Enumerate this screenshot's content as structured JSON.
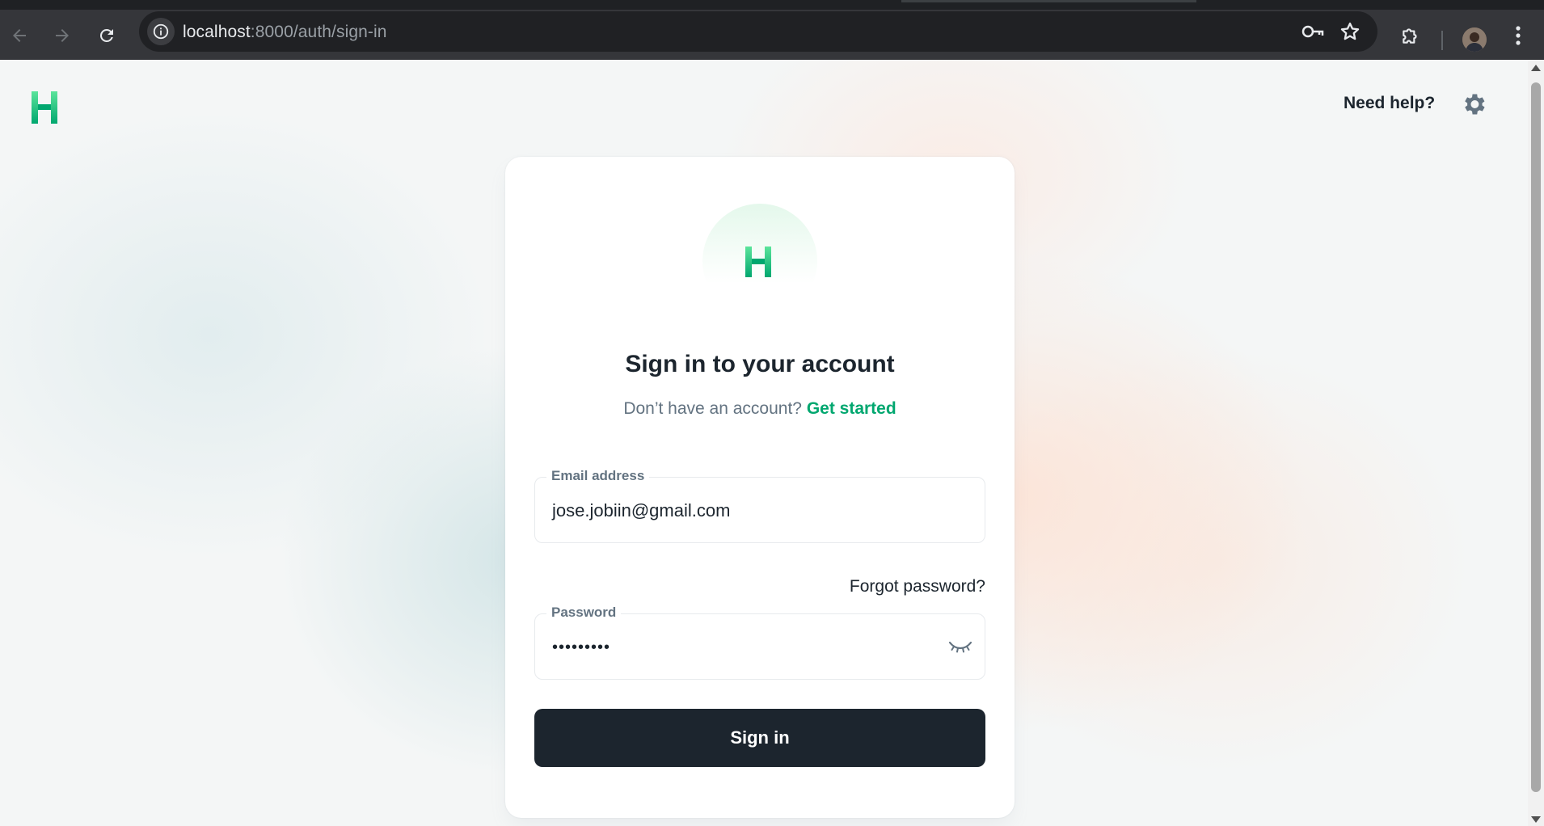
{
  "browser": {
    "url_host": "localhost",
    "url_rest": ":8000/auth/sign-in",
    "icons": {
      "back": "arrow-left-icon",
      "forward": "arrow-right-icon",
      "reload": "reload-icon",
      "site_info": "info-icon",
      "password_key": "key-icon",
      "bookmark": "star-icon",
      "extensions": "puzzle-icon",
      "profile": "avatar",
      "menu": "more-vertical-icon"
    }
  },
  "header": {
    "logo_letter": "H",
    "help_label": "Need help?",
    "settings_icon": "gear-icon"
  },
  "signin": {
    "logo_letter": "H",
    "title": "Sign in to your account",
    "subtitle": "Don’t have an account?",
    "get_started_label": "Get started",
    "email_label": "Email address",
    "email_value": "jose.jobiin@gmail.com",
    "forgot_label": "Forgot password?",
    "password_label": "Password",
    "password_value": "•••••••••",
    "password_toggle_icon": "eye-closed-icon",
    "submit_label": "Sign in"
  },
  "colors": {
    "brand_green": "#00a76f",
    "logo_green_top": "#5be49b",
    "logo_green_bottom": "#00a76f",
    "text_primary": "#1c252e",
    "text_secondary": "#637381",
    "button_dark": "#1c252e",
    "chrome_dark": "#35363a"
  }
}
